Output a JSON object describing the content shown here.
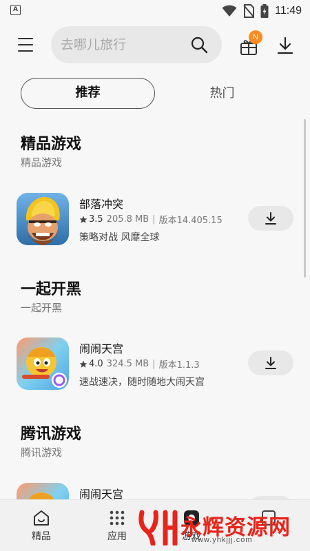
{
  "status_bar": {
    "time": "11:49",
    "left_icon_letter": "A",
    "icons": [
      "wifi-icon",
      "no-sim-icon",
      "battery-charging-icon"
    ]
  },
  "top_bar": {
    "search_placeholder": "去哪儿旅行",
    "gift_badge": "N"
  },
  "tabs": [
    {
      "label": "推荐",
      "selected": true
    },
    {
      "label": "热门",
      "selected": false
    }
  ],
  "sections": [
    {
      "title": "精品游戏",
      "subtitle": "精品游戏",
      "app": {
        "name": "部落冲突",
        "rating": "3.5",
        "size": "205.8 MB",
        "version": "版本14.405.15",
        "description": "策略对战 风靡全球",
        "icon": "clash-of-clans-icon"
      }
    },
    {
      "title": "一起开黑",
      "subtitle": "一起开黑",
      "app": {
        "name": "闹闹天宫",
        "rating": "4.0",
        "size": "324.5 MB",
        "version": "版本1.1.3",
        "description": "速战速决，随时随地大闹天宫",
        "icon": "nao-nao-tian-gong-icon"
      }
    },
    {
      "title": "腾讯游戏",
      "subtitle": "腾讯游戏",
      "app": {
        "name": "闹闹天宫",
        "icon": "nao-nao-tian-gong-icon"
      }
    }
  ],
  "bottom_nav": [
    {
      "label": "精品",
      "icon": "home-icon"
    },
    {
      "label": "应用",
      "icon": "apps-grid-icon"
    },
    {
      "label": "游戏",
      "icon": "game-icon"
    },
    {
      "label": "",
      "icon": "rank-icon"
    }
  ],
  "watermark": {
    "text": "永辉资源网",
    "url": "www.yhkjjj.com"
  },
  "colors": {
    "background": "#f7f7f7",
    "badge": "#ff8a1f",
    "watermark": "#e8241a"
  }
}
